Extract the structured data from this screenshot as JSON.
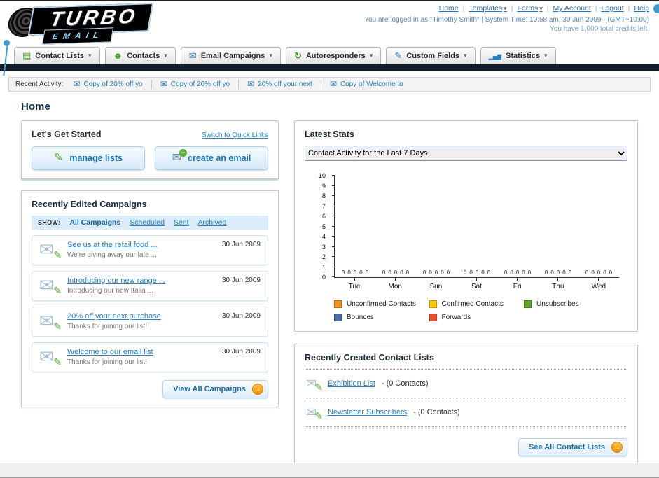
{
  "header": {
    "logo_line1": "TURBO",
    "logo_line2": "EMAIL",
    "links": [
      {
        "label": "Home",
        "dropdown": false
      },
      {
        "label": "Templates",
        "dropdown": true
      },
      {
        "label": "Forms",
        "dropdown": true
      },
      {
        "label": "My Account",
        "dropdown": false
      },
      {
        "label": "Logout",
        "dropdown": false
      },
      {
        "label": "Help",
        "dropdown": false
      }
    ],
    "login_info": "You are logged in as \"Timothy Smith\" | System Time: 10:58 am, 30 Jun 2009 - (GMT+10:00)",
    "credits_info": "You have 1,000 total credits left."
  },
  "nav": {
    "tabs": [
      {
        "label": "Contact Lists",
        "icon": "contact-lists-icon"
      },
      {
        "label": "Contacts",
        "icon": "contacts-icon"
      },
      {
        "label": "Email Campaigns",
        "icon": "email-campaigns-icon"
      },
      {
        "label": "Autoresponders",
        "icon": "autoresponders-icon"
      },
      {
        "label": "Custom Fields",
        "icon": "custom-fields-icon"
      },
      {
        "label": "Statistics",
        "icon": "statistics-icon"
      }
    ]
  },
  "recent_activity": {
    "label": "Recent Activity:",
    "items": [
      {
        "label": "Copy of 20% off yo",
        "icon": "envelope-icon"
      },
      {
        "label": "Copy of 20% off yo",
        "icon": "envelope-icon"
      },
      {
        "label": "20% off your next",
        "icon": "envelope-icon"
      },
      {
        "label": "Copy of Welcome to",
        "icon": "envelope-icon"
      }
    ]
  },
  "page_title": "Home",
  "get_started": {
    "title": "Let's Get Started",
    "switch_link": "Switch to Quick Links",
    "manage_lists_label": "manage lists",
    "create_email_label": "create an email"
  },
  "campaigns": {
    "title": "Recently Edited Campaigns",
    "show_label": "SHOW:",
    "filters": [
      {
        "label": "All Campaigns",
        "active": true
      },
      {
        "label": "Scheduled",
        "active": false
      },
      {
        "label": "Sent",
        "active": false
      },
      {
        "label": "Archived",
        "active": false
      }
    ],
    "items": [
      {
        "title": "See us at the retail food ...",
        "subtitle": "We're giving away our late ...",
        "date": "30 Jun 2009"
      },
      {
        "title": "Introducing our new range ...",
        "subtitle": "Introducing our new Italia ...",
        "date": "30 Jun 2009"
      },
      {
        "title": "20% off your next purchase",
        "subtitle": "Thanks for joining our list!",
        "date": "30 Jun 2009"
      },
      {
        "title": "Welcome to our email list",
        "subtitle": "Thanks for joining our list!",
        "date": "30 Jun 2009"
      }
    ],
    "view_all_label": "View All Campaigns"
  },
  "stats": {
    "title": "Latest Stats",
    "selected_option": "Contact Activity for the Last 7 Days"
  },
  "chart_data": {
    "type": "bar",
    "title": "Contact Activity for the Last 7 Days",
    "categories": [
      "Tue",
      "Mon",
      "Sun",
      "Sat",
      "Fri",
      "Thu",
      "Wed"
    ],
    "series": [
      {
        "name": "Unconfirmed Contacts",
        "color": "#f5941f",
        "values": [
          0,
          0,
          0,
          0,
          0,
          0,
          0
        ]
      },
      {
        "name": "Confirmed Contacts",
        "color": "#fdc800",
        "values": [
          0,
          0,
          0,
          0,
          0,
          0,
          0
        ]
      },
      {
        "name": "Unsubscribes",
        "color": "#61a622",
        "values": [
          0,
          0,
          0,
          0,
          0,
          0,
          0
        ]
      },
      {
        "name": "Bounces",
        "color": "#4a6fa5",
        "values": [
          0,
          0,
          0,
          0,
          0,
          0,
          0
        ]
      },
      {
        "name": "Forwards",
        "color": "#e8502c",
        "values": [
          0,
          0,
          0,
          0,
          0,
          0,
          0
        ]
      }
    ],
    "ylim": [
      0,
      10
    ],
    "ytick_step": 1,
    "grid": false,
    "legend_position": "bottom",
    "xlabel": "",
    "ylabel": ""
  },
  "contact_lists": {
    "title": "Recently Created Contact Lists",
    "items": [
      {
        "name": "Exhibition List",
        "detail": "- (0 Contacts)",
        "icon": "pencil-icon"
      },
      {
        "name": "Newsletter Subscribers",
        "detail": "- (0 Contacts)",
        "icon": "pencil-icon"
      }
    ],
    "see_all_label": "See All Contact Lists"
  }
}
